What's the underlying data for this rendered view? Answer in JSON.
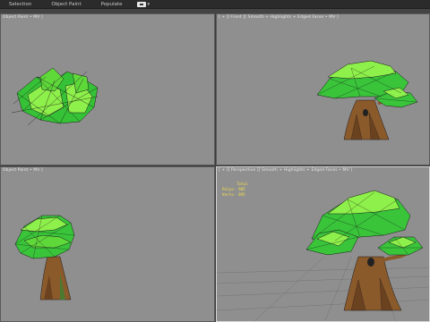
{
  "toolbar": {
    "tabs": [
      {
        "label": "Selection"
      },
      {
        "label": "Object Paint"
      },
      {
        "label": "Populate"
      }
    ],
    "icon": "viewport-toggle-icon"
  },
  "viewports": {
    "top_left": {
      "label": "Object Paint • MV ]"
    },
    "top_right": {
      "label": "[ + ][ Front ][ Smooth + Highlights + Edged Faces • MV ]"
    },
    "bottom_left": {
      "label": "Object Paint • MV ]"
    },
    "bottom_right": {
      "label": "[ + ][ Perspective ][ Smooth + Highlights + Edged Faces • MV ]",
      "stats": {
        "title": "Total",
        "polys_label": "Polys:",
        "polys_value": "985",
        "verts_label": "Verts:",
        "verts_value": "895"
      }
    }
  },
  "colors": {
    "viewport_bg": "#8f8f8f",
    "foliage": "#39c43a",
    "foliage_light": "#8ef04a",
    "trunk": "#8b5a2b",
    "wire": "#1a1a1a",
    "stats_text": "#f2e04a"
  }
}
